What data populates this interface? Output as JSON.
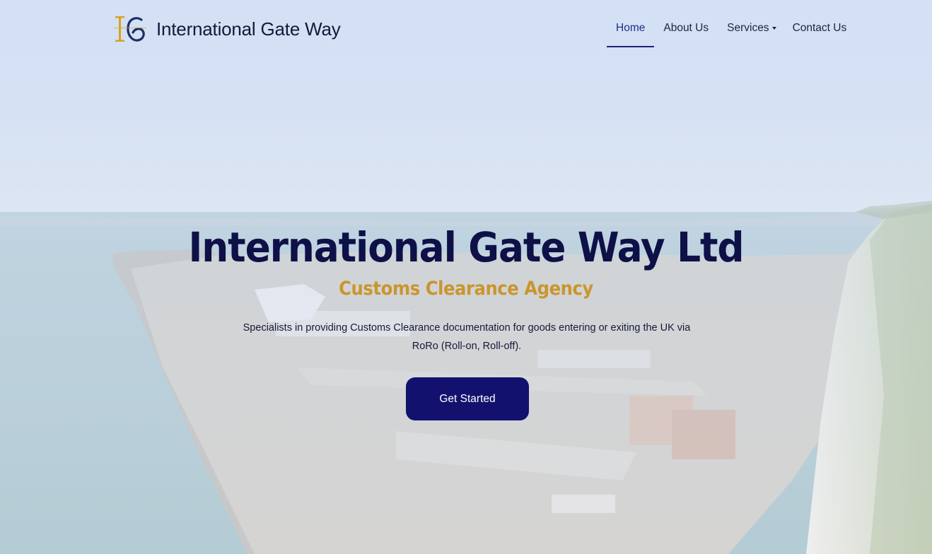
{
  "brand": {
    "name": "International Gate Way",
    "logo_icon": "ig-monogram-logo",
    "colors": {
      "navy": "#12116e",
      "gold": "#c9962d"
    }
  },
  "nav": {
    "items": [
      {
        "label": "Home",
        "active": true
      },
      {
        "label": "About Us",
        "active": false
      },
      {
        "label": "Services",
        "active": false,
        "has_dropdown": true
      },
      {
        "label": "Contact Us",
        "active": false
      }
    ]
  },
  "hero": {
    "title": "International Gate Way Ltd",
    "subtitle": "Customs Clearance Agency",
    "text": "Specialists in providing Customs Clearance documentation for goods entering or exiting the UK via RoRo (Roll-on, Roll-off).",
    "cta_label": "Get Started",
    "background": "port-aerial-image"
  }
}
